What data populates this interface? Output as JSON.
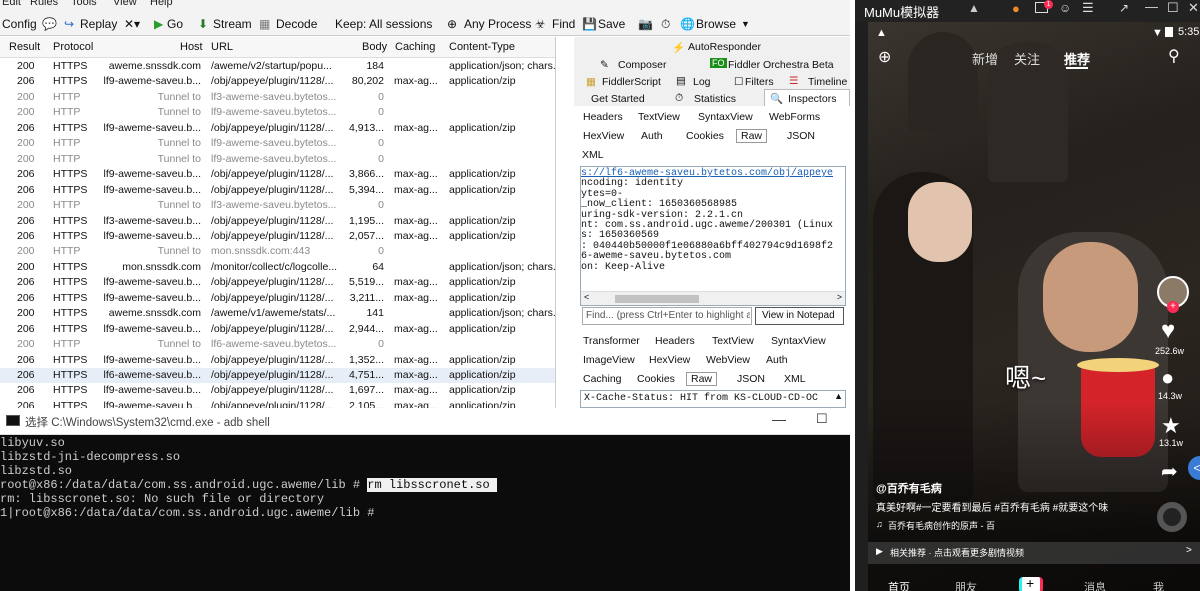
{
  "fiddler": {
    "menu": [
      "Edit",
      "Rules",
      "Tools",
      "View",
      "Help"
    ],
    "toolbar": {
      "config": "Config",
      "replay": "Replay",
      "go": "Go",
      "stream": "Stream",
      "decode": "Decode",
      "keep": "Keep: All sessions",
      "any_process": "Any Process",
      "find": "Find",
      "save": "Save",
      "browse": "Browse"
    },
    "columns": [
      "Result",
      "Protocol",
      "Host",
      "URL",
      "Body",
      "Caching",
      "Content-Type"
    ],
    "rows": [
      {
        "result": "200",
        "protocol": "HTTPS",
        "host": "aweme.snssdk.com",
        "url": "/aweme/v2/startup/popu...",
        "body": "184",
        "caching": "",
        "ctype": "application/json; chars...",
        "gray": false
      },
      {
        "result": "206",
        "protocol": "HTTPS",
        "host": "lf9-aweme-saveu.b...",
        "url": "/obj/appeye/plugin/1128/...",
        "body": "80,202",
        "caching": "max-ag...",
        "ctype": "application/zip",
        "gray": false
      },
      {
        "result": "200",
        "protocol": "HTTP",
        "host": "Tunnel to",
        "url": "lf3-aweme-saveu.bytetos...",
        "body": "0",
        "caching": "",
        "ctype": "",
        "gray": true
      },
      {
        "result": "200",
        "protocol": "HTTP",
        "host": "Tunnel to",
        "url": "lf9-aweme-saveu.bytetos...",
        "body": "0",
        "caching": "",
        "ctype": "",
        "gray": true
      },
      {
        "result": "206",
        "protocol": "HTTPS",
        "host": "lf9-aweme-saveu.b...",
        "url": "/obj/appeye/plugin/1128/...",
        "body": "4,913...",
        "caching": "max-ag...",
        "ctype": "application/zip",
        "gray": false
      },
      {
        "result": "200",
        "protocol": "HTTP",
        "host": "Tunnel to",
        "url": "lf9-aweme-saveu.bytetos...",
        "body": "0",
        "caching": "",
        "ctype": "",
        "gray": true
      },
      {
        "result": "200",
        "protocol": "HTTP",
        "host": "Tunnel to",
        "url": "lf9-aweme-saveu.bytetos...",
        "body": "0",
        "caching": "",
        "ctype": "",
        "gray": true
      },
      {
        "result": "206",
        "protocol": "HTTPS",
        "host": "lf9-aweme-saveu.b...",
        "url": "/obj/appeye/plugin/1128/...",
        "body": "3,866...",
        "caching": "max-ag...",
        "ctype": "application/zip",
        "gray": false
      },
      {
        "result": "206",
        "protocol": "HTTPS",
        "host": "lf9-aweme-saveu.b...",
        "url": "/obj/appeye/plugin/1128/...",
        "body": "5,394...",
        "caching": "max-ag...",
        "ctype": "application/zip",
        "gray": false
      },
      {
        "result": "200",
        "protocol": "HTTP",
        "host": "Tunnel to",
        "url": "lf3-aweme-saveu.bytetos...",
        "body": "0",
        "caching": "",
        "ctype": "",
        "gray": true
      },
      {
        "result": "206",
        "protocol": "HTTPS",
        "host": "lf3-aweme-saveu.b...",
        "url": "/obj/appeye/plugin/1128/...",
        "body": "1,195...",
        "caching": "max-ag...",
        "ctype": "application/zip",
        "gray": false
      },
      {
        "result": "206",
        "protocol": "HTTPS",
        "host": "lf9-aweme-saveu.b...",
        "url": "/obj/appeye/plugin/1128/...",
        "body": "2,057...",
        "caching": "max-ag...",
        "ctype": "application/zip",
        "gray": false
      },
      {
        "result": "200",
        "protocol": "HTTP",
        "host": "Tunnel to",
        "url": "mon.snssdk.com:443",
        "body": "0",
        "caching": "",
        "ctype": "",
        "gray": true
      },
      {
        "result": "200",
        "protocol": "HTTPS",
        "host": "mon.snssdk.com",
        "url": "/monitor/collect/c/logcolle...",
        "body": "64",
        "caching": "",
        "ctype": "application/json; chars...",
        "gray": false
      },
      {
        "result": "206",
        "protocol": "HTTPS",
        "host": "lf9-aweme-saveu.b...",
        "url": "/obj/appeye/plugin/1128/...",
        "body": "5,519...",
        "caching": "max-ag...",
        "ctype": "application/zip",
        "gray": false
      },
      {
        "result": "206",
        "protocol": "HTTPS",
        "host": "lf9-aweme-saveu.b...",
        "url": "/obj/appeye/plugin/1128/...",
        "body": "3,211...",
        "caching": "max-ag...",
        "ctype": "application/zip",
        "gray": false
      },
      {
        "result": "200",
        "protocol": "HTTPS",
        "host": "aweme.snssdk.com",
        "url": "/aweme/v1/aweme/stats/...",
        "body": "141",
        "caching": "",
        "ctype": "application/json; chars...",
        "gray": false
      },
      {
        "result": "206",
        "protocol": "HTTPS",
        "host": "lf9-aweme-saveu.b...",
        "url": "/obj/appeye/plugin/1128/...",
        "body": "2,944...",
        "caching": "max-ag...",
        "ctype": "application/zip",
        "gray": false
      },
      {
        "result": "200",
        "protocol": "HTTP",
        "host": "Tunnel to",
        "url": "lf6-aweme-saveu.bytetos...",
        "body": "0",
        "caching": "",
        "ctype": "",
        "gray": true
      },
      {
        "result": "206",
        "protocol": "HTTPS",
        "host": "lf9-aweme-saveu.b...",
        "url": "/obj/appeye/plugin/1128/...",
        "body": "1,352...",
        "caching": "max-ag...",
        "ctype": "application/zip",
        "gray": false
      },
      {
        "result": "206",
        "protocol": "HTTPS",
        "host": "lf6-aweme-saveu.b...",
        "url": "/obj/appeye/plugin/1128/...",
        "body": "4,751...",
        "caching": "max-ag...",
        "ctype": "application/zip",
        "gray": false
      },
      {
        "result": "206",
        "protocol": "HTTPS",
        "host": "lf9-aweme-saveu.b...",
        "url": "/obj/appeye/plugin/1128/...",
        "body": "1,697...",
        "caching": "max-ag...",
        "ctype": "application/zip",
        "gray": false
      },
      {
        "result": "206",
        "protocol": "HTTPS",
        "host": "lf9-aweme-saveu.b...",
        "url": "/obj/appeye/plugin/1128/...",
        "body": "2,105...",
        "caching": "max-ag...",
        "ctype": "application/zip",
        "gray": false
      }
    ],
    "inspector": {
      "autoresponder": "AutoResponder",
      "composer": "Composer",
      "orchestra": "Fiddler Orchestra Beta",
      "fiddlerscript": "FiddlerScript",
      "log": "Log",
      "filters": "Filters",
      "timeline": "Timeline",
      "get_started": "Get Started",
      "statistics": "Statistics",
      "inspectors": "Inspectors",
      "req_tabs": [
        "Headers",
        "TextView",
        "SyntaxView",
        "WebForms",
        "HexView",
        "Auth",
        "Cookies",
        "Raw",
        "JSON",
        "XML"
      ],
      "req_raw": [
        "s://lf6-aweme-saveu.bytetos.com/obj/appeye",
        "ncoding: identity",
        "ytes=0-",
        "_now_client: 1650360568985",
        "uring-sdk-version: 2.2.1.cn",
        "nt: com.ss.android.ugc.aweme/200301 (Linux",
        "s: 1650360569",
        ": 040440b50000f1e06880a6bff402794c9d1698f2",
        "6-aweme-saveu.bytetos.com",
        "on: Keep-Alive"
      ],
      "find_placeholder": "Find... (press Ctrl+Enter to highlight all)",
      "view_notepad": "View in Notepad",
      "resp_tabs": [
        "Transformer",
        "Headers",
        "TextView",
        "SyntaxView",
        "ImageView",
        "HexView",
        "WebView",
        "Auth",
        "Caching",
        "Cookies",
        "Raw",
        "JSON",
        "XML"
      ],
      "resp_raw": "X-Cache-Status: HIT from KS-CLOUD-CD-OC"
    }
  },
  "cmd": {
    "title": "选择 C:\\Windows\\System32\\cmd.exe - adb  shell",
    "lines": [
      "libyuv.so",
      "libzstd-jni-decompress.so",
      "libzstd.so",
      "root@x86:/data/data/com.ss.android.ugc.aweme/lib # ",
      "rm: libsscronet.so: No such file or directory",
      "1|root@x86:/data/data/com.ss.android.ugc.aweme/lib #"
    ],
    "selected_cmd": "rm libsscronet.so "
  },
  "mumu": {
    "title": "MuMu模拟器",
    "status_time": "5:35",
    "tabs": [
      "新增",
      "关注",
      "推荐"
    ],
    "caption_big": "嗯~",
    "counts": [
      "252.6w",
      "14.3w",
      "13.1w"
    ],
    "author": "@百乔有毛病",
    "desc": "真美好啊#一定要看到最后 #百乔有毛病 #就要这个味",
    "music": "百乔有毛病创作的原声 - 百",
    "related": "相关推荐 · 点击观看更多剧情视频",
    "bottom_nav": [
      "首页",
      "朋友",
      "+",
      "消息",
      "我"
    ],
    "colors": {
      "accent": "#fe2c55",
      "bg": "#1f1f1f"
    }
  }
}
